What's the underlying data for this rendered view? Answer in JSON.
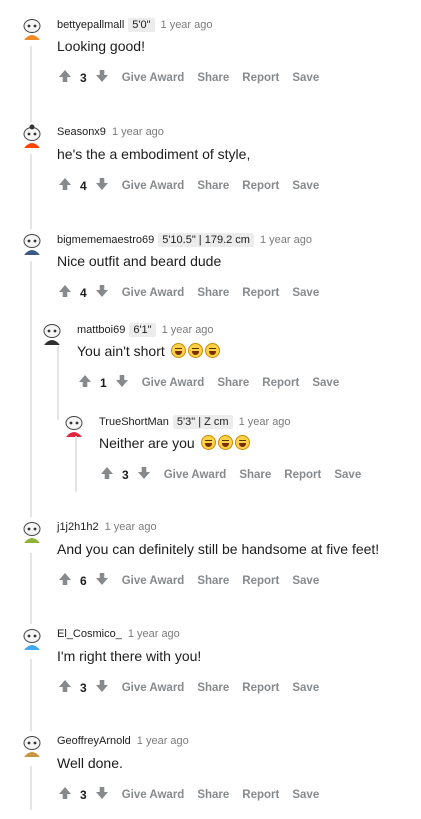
{
  "actions": {
    "give_award": "Give Award",
    "share": "Share",
    "report": "Report",
    "save": "Save"
  },
  "comments": [
    {
      "user": "bettyepallmall",
      "flair": "5'0\"",
      "time": "1 year ago",
      "text": "Looking good!",
      "score": "3",
      "avatar_color": "#f08a24"
    },
    {
      "user": "Seasonx9",
      "flair": "",
      "time": "1 year ago",
      "text": "he's the a embodiment of style,",
      "score": "4",
      "avatar_color": "#ff4500"
    },
    {
      "user": "bigmememaestro69",
      "flair": "5'10.5\" | 179.2 cm",
      "time": "1 year ago",
      "text": "Nice outfit and beard dude",
      "score": "4",
      "avatar_color": "#3d5a80"
    },
    {
      "user": "mattboi69",
      "flair": "6'1\"",
      "time": "1 year ago",
      "text": "You ain't short",
      "emojis": 3,
      "score": "1",
      "avatar_color": "#2f2f2f"
    },
    {
      "user": "TrueShortMan",
      "flair": "5'3\" | Z cm",
      "time": "1 year ago",
      "text": "Neither are you",
      "emojis": 3,
      "score": "3",
      "avatar_color": "#e2263b"
    },
    {
      "user": "j1j2h1h2",
      "flair": "",
      "time": "1 year ago",
      "text": "And you can definitely still be handsome at five feet!",
      "score": "6",
      "avatar_color": "#8fb339"
    },
    {
      "user": "El_Cosmico_",
      "flair": "",
      "time": "1 year ago",
      "text": "I'm right there with you!",
      "score": "3",
      "avatar_color": "#3fa9f5"
    },
    {
      "user": "GeoffreyArnold",
      "flair": "",
      "time": "1 year ago",
      "text": "Well done.",
      "score": "3",
      "avatar_color": "#c8963e"
    }
  ],
  "icons": {
    "upvote": "upvote-icon",
    "downvote": "downvote-icon",
    "emoji": "laughing-emoji-icon"
  }
}
